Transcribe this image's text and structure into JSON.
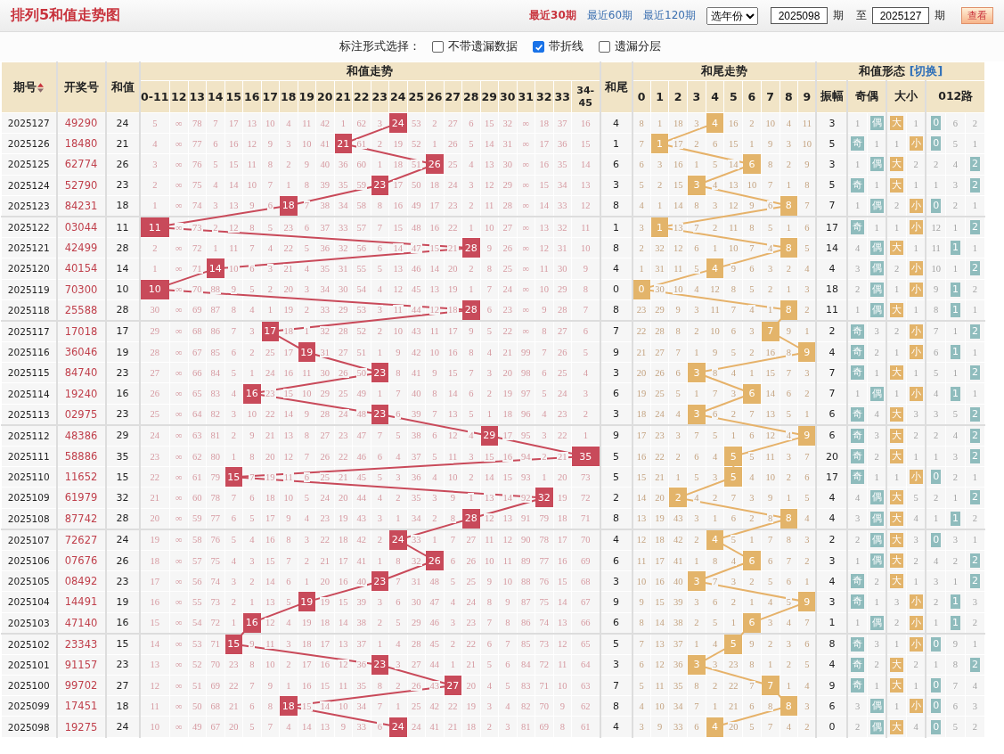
{
  "header": {
    "title": "排列5和值走势图",
    "period_links": [
      {
        "label": "最近30期",
        "selected": true
      },
      {
        "label": "最近60期",
        "selected": false
      },
      {
        "label": "最近120期",
        "selected": false
      }
    ],
    "year_select": "选年份",
    "from_issue": "2025098",
    "from_suffix": "期",
    "to_label": "至",
    "to_issue": "2025127",
    "to_suffix": "期",
    "view_button": "查看"
  },
  "options": {
    "label": "标注形式选择：",
    "checkboxes": [
      {
        "label": "不带遗漏数据",
        "checked": false
      },
      {
        "label": "带折线",
        "checked": true
      },
      {
        "label": "遗漏分层",
        "checked": false
      }
    ]
  },
  "table": {
    "issue_header": "期号",
    "number_header": "开奖号",
    "sum_header": "和值",
    "sum_trend_header": "和值走势",
    "tail_header": "和尾",
    "tail_trend_header": "和尾走势",
    "form_header": "和值形态",
    "switch_link": "[切换]",
    "amplitude_header": "振幅",
    "odd_even_header": "奇偶",
    "big_small_header": "大小",
    "route_header": "012路",
    "sum_columns": [
      "0-11",
      "12",
      "13",
      "14",
      "15",
      "16",
      "17",
      "18",
      "19",
      "20",
      "21",
      "22",
      "23",
      "24",
      "25",
      "26",
      "27",
      "28",
      "29",
      "30",
      "31",
      "32",
      "33",
      "34-45"
    ],
    "tail_columns": [
      "0",
      "1",
      "2",
      "3",
      "4",
      "5",
      "6",
      "7",
      "8",
      "9"
    ],
    "rows": [
      {
        "issue": "2025127",
        "number": "49290",
        "sum": "24",
        "sum_trend": [
          "5",
          "∞",
          "78",
          "7",
          "17",
          "13",
          "10",
          "4",
          "11",
          "42",
          "1",
          "62",
          "3",
          {
            "value": "24",
            "hit": true
          },
          "53",
          "2",
          "27",
          "6",
          "15",
          "32",
          "∞",
          "18",
          "37",
          "16"
        ],
        "tail": "4",
        "tail_trend": [
          "8",
          "1",
          "18",
          "3",
          {
            "value": "4",
            "hit": true
          },
          "16",
          "2",
          "10",
          "4",
          "11"
        ],
        "amplitude": "3",
        "odd_even": [
          "1",
          {
            "value": "偶",
            "hit": true
          }
        ],
        "big_small": [
          {
            "value": "大",
            "hit": true
          },
          "1"
        ],
        "route_012": [
          {
            "value": "0",
            "hit": true
          },
          "6",
          "2"
        ]
      },
      {
        "issue": "2025126",
        "number": "18480",
        "sum": "21",
        "sum_trend": [
          "4",
          "∞",
          "77",
          "6",
          "16",
          "12",
          "9",
          "3",
          "10",
          "41",
          {
            "value": "21",
            "hit": true
          },
          "61",
          "2",
          "19",
          "52",
          "1",
          "26",
          "5",
          "14",
          "31",
          "∞",
          "17",
          "36",
          "15"
        ],
        "tail": "1",
        "tail_trend": [
          "7",
          {
            "value": "1",
            "hit": true
          },
          "17",
          "2",
          "6",
          "15",
          "1",
          "9",
          "3",
          "10"
        ],
        "amplitude": "5",
        "odd_even": [
          {
            "value": "奇",
            "hit": true
          },
          "1"
        ],
        "big_small": [
          "1",
          {
            "value": "小",
            "hit": true
          }
        ],
        "route_012": [
          {
            "value": "0",
            "hit": true
          },
          "5",
          "1"
        ]
      },
      {
        "issue": "2025125",
        "number": "62774",
        "sum": "26",
        "sum_trend": [
          "3",
          "∞",
          "76",
          "5",
          "15",
          "11",
          "8",
          "2",
          "9",
          "40",
          "36",
          "60",
          "1",
          "18",
          "51",
          {
            "value": "26",
            "hit": true
          },
          "25",
          "4",
          "13",
          "30",
          "∞",
          "16",
          "35",
          "14"
        ],
        "tail": "6",
        "tail_trend": [
          "6",
          "3",
          "16",
          "1",
          "5",
          "14",
          {
            "value": "6",
            "hit": true
          },
          "8",
          "2",
          "9"
        ],
        "amplitude": "3",
        "odd_even": [
          "1",
          {
            "value": "偶",
            "hit": true
          }
        ],
        "big_small": [
          {
            "value": "大",
            "hit": true
          },
          "2"
        ],
        "route_012": [
          "2",
          "4",
          {
            "value": "2",
            "hit": true
          }
        ]
      },
      {
        "issue": "2025124",
        "number": "52790",
        "sum": "23",
        "sum_trend": [
          "2",
          "∞",
          "75",
          "4",
          "14",
          "10",
          "7",
          "1",
          "8",
          "39",
          "35",
          "59",
          {
            "value": "23",
            "hit": true
          },
          "17",
          "50",
          "18",
          "24",
          "3",
          "12",
          "29",
          "∞",
          "15",
          "34",
          "13"
        ],
        "tail": "3",
        "tail_trend": [
          "5",
          "2",
          "15",
          {
            "value": "3",
            "hit": true
          },
          "4",
          "13",
          "10",
          "7",
          "1",
          "8"
        ],
        "amplitude": "5",
        "odd_even": [
          {
            "value": "奇",
            "hit": true
          },
          "1"
        ],
        "big_small": [
          {
            "value": "大",
            "hit": true
          },
          "1"
        ],
        "route_012": [
          "1",
          "3",
          {
            "value": "2",
            "hit": true
          }
        ]
      },
      {
        "issue": "2025123",
        "number": "84231",
        "sum": "18",
        "sum_trend": [
          "1",
          "∞",
          "74",
          "3",
          "13",
          "9",
          "6",
          {
            "value": "18",
            "hit": true
          },
          "7",
          "38",
          "34",
          "58",
          "8",
          "16",
          "49",
          "17",
          "23",
          "2",
          "11",
          "28",
          "∞",
          "14",
          "33",
          "12"
        ],
        "tail": "8",
        "tail_trend": [
          "4",
          "1",
          "14",
          "8",
          "3",
          "12",
          "9",
          "6",
          {
            "value": "8",
            "hit": true
          },
          "7"
        ],
        "amplitude": "7",
        "odd_even": [
          "1",
          {
            "value": "偶",
            "hit": true
          }
        ],
        "big_small": [
          "2",
          {
            "value": "小",
            "hit": true
          }
        ],
        "route_012": [
          {
            "value": "0",
            "hit": true
          },
          "2",
          "1"
        ]
      },
      {
        "issue": "2025122",
        "number": "03044",
        "sum": "11",
        "sum_trend": [
          {
            "value": "11",
            "hit": true
          },
          "∞",
          "73",
          "2",
          "12",
          "8",
          "5",
          "23",
          "6",
          "37",
          "33",
          "57",
          "7",
          "15",
          "48",
          "16",
          "22",
          "1",
          "10",
          "27",
          "∞",
          "13",
          "32",
          "11"
        ],
        "tail": "1",
        "tail_trend": [
          "3",
          {
            "value": "1",
            "hit": true
          },
          "13",
          "7",
          "2",
          "11",
          "8",
          "5",
          "1",
          "6"
        ],
        "amplitude": "17",
        "odd_even": [
          {
            "value": "奇",
            "hit": true
          },
          "1"
        ],
        "big_small": [
          "1",
          {
            "value": "小",
            "hit": true
          }
        ],
        "route_012": [
          "12",
          "1",
          {
            "value": "2",
            "hit": true
          }
        ]
      },
      {
        "issue": "2025121",
        "number": "42499",
        "sum": "28",
        "sum_trend": [
          "2",
          "∞",
          "72",
          "1",
          "11",
          "7",
          "4",
          "22",
          "5",
          "36",
          "32",
          "56",
          "6",
          "14",
          "47",
          "15",
          "21",
          {
            "value": "28",
            "hit": true
          },
          "9",
          "26",
          "∞",
          "12",
          "31",
          "10"
        ],
        "tail": "8",
        "tail_trend": [
          "2",
          "32",
          "12",
          "6",
          "1",
          "10",
          "7",
          "4",
          {
            "value": "8",
            "hit": true
          },
          "5"
        ],
        "amplitude": "14",
        "odd_even": [
          "4",
          {
            "value": "偶",
            "hit": true
          }
        ],
        "big_small": [
          {
            "value": "大",
            "hit": true
          },
          "1"
        ],
        "route_012": [
          "11",
          {
            "value": "1",
            "hit": true
          },
          "1"
        ]
      },
      {
        "issue": "2025120",
        "number": "40154",
        "sum": "14",
        "sum_trend": [
          "1",
          "∞",
          "71",
          {
            "value": "14",
            "hit": true
          },
          "10",
          "6",
          "3",
          "21",
          "4",
          "35",
          "31",
          "55",
          "5",
          "13",
          "46",
          "14",
          "20",
          "2",
          "8",
          "25",
          "∞",
          "11",
          "30",
          "9"
        ],
        "tail": "4",
        "tail_trend": [
          "1",
          "31",
          "11",
          "5",
          {
            "value": "4",
            "hit": true
          },
          "9",
          "6",
          "3",
          "2",
          "4"
        ],
        "amplitude": "4",
        "odd_even": [
          "3",
          {
            "value": "偶",
            "hit": true
          }
        ],
        "big_small": [
          "2",
          {
            "value": "小",
            "hit": true
          }
        ],
        "route_012": [
          "10",
          "1",
          {
            "value": "2",
            "hit": true
          }
        ]
      },
      {
        "issue": "2025119",
        "number": "70300",
        "sum": "10",
        "sum_trend": [
          {
            "value": "10",
            "hit": true
          },
          "∞",
          "70",
          "88",
          "9",
          "5",
          "2",
          "20",
          "3",
          "34",
          "30",
          "54",
          "4",
          "12",
          "45",
          "13",
          "19",
          "1",
          "7",
          "24",
          "∞",
          "10",
          "29",
          "8"
        ],
        "tail": "0",
        "tail_trend": [
          {
            "value": "0",
            "hit": true
          },
          "30",
          "10",
          "4",
          "12",
          "8",
          "5",
          "2",
          "1",
          "3"
        ],
        "amplitude": "18",
        "odd_even": [
          "2",
          {
            "value": "偶",
            "hit": true
          }
        ],
        "big_small": [
          "1",
          {
            "value": "小",
            "hit": true
          }
        ],
        "route_012": [
          "9",
          {
            "value": "1",
            "hit": true
          },
          "2"
        ]
      },
      {
        "issue": "2025118",
        "number": "25588",
        "sum": "28",
        "sum_trend": [
          "30",
          "∞",
          "69",
          "87",
          "8",
          "4",
          "1",
          "19",
          "2",
          "33",
          "29",
          "53",
          "3",
          "11",
          "44",
          "12",
          "18",
          {
            "value": "28",
            "hit": true
          },
          "6",
          "23",
          "∞",
          "9",
          "28",
          "7"
        ],
        "tail": "8",
        "tail_trend": [
          "23",
          "29",
          "9",
          "3",
          "11",
          "7",
          "4",
          "1",
          {
            "value": "8",
            "hit": true
          },
          "2"
        ],
        "amplitude": "11",
        "odd_even": [
          "1",
          {
            "value": "偶",
            "hit": true
          }
        ],
        "big_small": [
          {
            "value": "大",
            "hit": true
          },
          "1"
        ],
        "route_012": [
          "8",
          {
            "value": "1",
            "hit": true
          },
          "1"
        ]
      },
      {
        "issue": "2025117",
        "number": "17018",
        "sum": "17",
        "sum_trend": [
          "29",
          "∞",
          "68",
          "86",
          "7",
          "3",
          {
            "value": "17",
            "hit": true
          },
          "18",
          "1",
          "32",
          "28",
          "52",
          "2",
          "10",
          "43",
          "11",
          "17",
          "9",
          "5",
          "22",
          "∞",
          "8",
          "27",
          "6"
        ],
        "tail": "7",
        "tail_trend": [
          "22",
          "28",
          "8",
          "2",
          "10",
          "6",
          "3",
          {
            "value": "7",
            "hit": true
          },
          "9",
          "1"
        ],
        "amplitude": "2",
        "odd_even": [
          {
            "value": "奇",
            "hit": true
          },
          "3"
        ],
        "big_small": [
          "2",
          {
            "value": "小",
            "hit": true
          }
        ],
        "route_012": [
          "7",
          "1",
          {
            "value": "2",
            "hit": true
          }
        ]
      },
      {
        "issue": "2025116",
        "number": "36046",
        "sum": "19",
        "sum_trend": [
          "28",
          "∞",
          "67",
          "85",
          "6",
          "2",
          "25",
          "17",
          {
            "value": "19",
            "hit": true
          },
          "31",
          "27",
          "51",
          "1",
          "9",
          "42",
          "10",
          "16",
          "8",
          "4",
          "21",
          "99",
          "7",
          "26",
          "5"
        ],
        "tail": "9",
        "tail_trend": [
          "21",
          "27",
          "7",
          "1",
          "9",
          "5",
          "2",
          "16",
          "8",
          {
            "value": "9",
            "hit": true
          }
        ],
        "amplitude": "4",
        "odd_even": [
          {
            "value": "奇",
            "hit": true
          },
          "2"
        ],
        "big_small": [
          "1",
          {
            "value": "小",
            "hit": true
          }
        ],
        "route_012": [
          "6",
          {
            "value": "1",
            "hit": true
          },
          "1"
        ]
      },
      {
        "issue": "2025115",
        "number": "84740",
        "sum": "23",
        "sum_trend": [
          "27",
          "∞",
          "66",
          "84",
          "5",
          "1",
          "24",
          "16",
          "11",
          "30",
          "26",
          "50",
          {
            "value": "23",
            "hit": true
          },
          "8",
          "41",
          "9",
          "15",
          "7",
          "3",
          "20",
          "98",
          "6",
          "25",
          "4"
        ],
        "tail": "3",
        "tail_trend": [
          "20",
          "26",
          "6",
          {
            "value": "3",
            "hit": true
          },
          "8",
          "4",
          "1",
          "15",
          "7",
          "3"
        ],
        "amplitude": "7",
        "odd_even": [
          {
            "value": "奇",
            "hit": true
          },
          "1"
        ],
        "big_small": [
          {
            "value": "大",
            "hit": true
          },
          "1"
        ],
        "route_012": [
          "5",
          "1",
          {
            "value": "2",
            "hit": true
          }
        ]
      },
      {
        "issue": "2025114",
        "number": "19240",
        "sum": "16",
        "sum_trend": [
          "26",
          "∞",
          "65",
          "83",
          "4",
          {
            "value": "16",
            "hit": true
          },
          "23",
          "15",
          "10",
          "29",
          "25",
          "49",
          "1",
          "7",
          "40",
          "8",
          "14",
          "6",
          "2",
          "19",
          "97",
          "5",
          "24",
          "3"
        ],
        "tail": "6",
        "tail_trend": [
          "19",
          "25",
          "5",
          "1",
          "7",
          "3",
          {
            "value": "6",
            "hit": true
          },
          "14",
          "6",
          "2"
        ],
        "amplitude": "7",
        "odd_even": [
          "1",
          {
            "value": "偶",
            "hit": true
          }
        ],
        "big_small": [
          "1",
          {
            "value": "小",
            "hit": true
          }
        ],
        "route_012": [
          "4",
          {
            "value": "1",
            "hit": true
          },
          "1"
        ]
      },
      {
        "issue": "2025113",
        "number": "02975",
        "sum": "23",
        "sum_trend": [
          "25",
          "∞",
          "64",
          "82",
          "3",
          "10",
          "22",
          "14",
          "9",
          "28",
          "24",
          "48",
          {
            "value": "23",
            "hit": true
          },
          "6",
          "39",
          "7",
          "13",
          "5",
          "1",
          "18",
          "96",
          "4",
          "23",
          "2"
        ],
        "tail": "3",
        "tail_trend": [
          "18",
          "24",
          "4",
          {
            "value": "3",
            "hit": true
          },
          "6",
          "2",
          "7",
          "13",
          "5",
          "1"
        ],
        "amplitude": "6",
        "odd_even": [
          {
            "value": "奇",
            "hit": true
          },
          "4"
        ],
        "big_small": [
          {
            "value": "大",
            "hit": true
          },
          "3"
        ],
        "route_012": [
          "3",
          "5",
          {
            "value": "2",
            "hit": true
          }
        ]
      },
      {
        "issue": "2025112",
        "number": "48386",
        "sum": "29",
        "sum_trend": [
          "24",
          "∞",
          "63",
          "81",
          "2",
          "9",
          "21",
          "13",
          "8",
          "27",
          "23",
          "47",
          "7",
          "5",
          "38",
          "6",
          "12",
          "4",
          {
            "value": "29",
            "hit": true
          },
          "17",
          "95",
          "3",
          "22",
          "1"
        ],
        "tail": "9",
        "tail_trend": [
          "17",
          "23",
          "3",
          "7",
          "5",
          "1",
          "6",
          "12",
          "4",
          {
            "value": "9",
            "hit": true
          }
        ],
        "amplitude": "6",
        "odd_even": [
          {
            "value": "奇",
            "hit": true
          },
          "3"
        ],
        "big_small": [
          {
            "value": "大",
            "hit": true
          },
          "2"
        ],
        "route_012": [
          "2",
          "4",
          {
            "value": "2",
            "hit": true
          }
        ]
      },
      {
        "issue": "2025111",
        "number": "58886",
        "sum": "35",
        "sum_trend": [
          "23",
          "∞",
          "62",
          "80",
          "1",
          "8",
          "20",
          "12",
          "7",
          "26",
          "22",
          "46",
          "6",
          "4",
          "37",
          "5",
          "11",
          "3",
          "15",
          "16",
          "94",
          "2",
          "21",
          {
            "value": "35",
            "hit": true
          }
        ],
        "tail": "5",
        "tail_trend": [
          "16",
          "22",
          "2",
          "6",
          "4",
          {
            "value": "5",
            "hit": true
          },
          "5",
          "11",
          "3",
          "7"
        ],
        "amplitude": "20",
        "odd_even": [
          {
            "value": "奇",
            "hit": true
          },
          "2"
        ],
        "big_small": [
          {
            "value": "大",
            "hit": true
          },
          "1"
        ],
        "route_012": [
          "1",
          "3",
          {
            "value": "2",
            "hit": true
          }
        ]
      },
      {
        "issue": "2025110",
        "number": "11652",
        "sum": "15",
        "sum_trend": [
          "22",
          "∞",
          "61",
          "79",
          {
            "value": "15",
            "hit": true
          },
          "7",
          "19",
          "11",
          "6",
          "25",
          "21",
          "45",
          "5",
          "3",
          "36",
          "4",
          "10",
          "2",
          "14",
          "15",
          "93",
          "1",
          "20",
          "73"
        ],
        "tail": "5",
        "tail_trend": [
          "15",
          "21",
          "1",
          "5",
          "3",
          {
            "value": "5",
            "hit": true
          },
          "4",
          "10",
          "2",
          "6"
        ],
        "amplitude": "17",
        "odd_even": [
          {
            "value": "奇",
            "hit": true
          },
          "1"
        ],
        "big_small": [
          "1",
          {
            "value": "小",
            "hit": true
          }
        ],
        "route_012": [
          {
            "value": "0",
            "hit": true
          },
          "2",
          "1"
        ]
      },
      {
        "issue": "2025109",
        "number": "61979",
        "sum": "32",
        "sum_trend": [
          "21",
          "∞",
          "60",
          "78",
          "7",
          "6",
          "18",
          "10",
          "5",
          "24",
          "20",
          "44",
          "4",
          "2",
          "35",
          "3",
          "9",
          "1",
          "13",
          "14",
          "92",
          {
            "value": "32",
            "hit": true
          },
          "19",
          "72"
        ],
        "tail": "2",
        "tail_trend": [
          "14",
          "20",
          {
            "value": "2",
            "hit": true
          },
          "4",
          "2",
          "7",
          "3",
          "9",
          "1",
          "5"
        ],
        "amplitude": "4",
        "odd_even": [
          "4",
          {
            "value": "偶",
            "hit": true
          }
        ],
        "big_small": [
          {
            "value": "大",
            "hit": true
          },
          "5"
        ],
        "route_012": [
          "2",
          "1",
          {
            "value": "2",
            "hit": true
          }
        ]
      },
      {
        "issue": "2025108",
        "number": "87742",
        "sum": "28",
        "sum_trend": [
          "20",
          "∞",
          "59",
          "77",
          "6",
          "5",
          "17",
          "9",
          "4",
          "23",
          "19",
          "43",
          "3",
          "1",
          "34",
          "2",
          "8",
          {
            "value": "28",
            "hit": true
          },
          "12",
          "13",
          "91",
          "79",
          "18",
          "71"
        ],
        "tail": "8",
        "tail_trend": [
          "13",
          "19",
          "43",
          "3",
          "1",
          "6",
          "2",
          "8",
          {
            "value": "8",
            "hit": true
          },
          "4"
        ],
        "amplitude": "4",
        "odd_even": [
          "3",
          {
            "value": "偶",
            "hit": true
          }
        ],
        "big_small": [
          {
            "value": "大",
            "hit": true
          },
          "4"
        ],
        "route_012": [
          "1",
          {
            "value": "1",
            "hit": true
          },
          "2"
        ]
      },
      {
        "issue": "2025107",
        "number": "72627",
        "sum": "24",
        "sum_trend": [
          "19",
          "∞",
          "58",
          "76",
          "5",
          "4",
          "16",
          "8",
          "3",
          "22",
          "18",
          "42",
          "2",
          {
            "value": "24",
            "hit": true
          },
          "33",
          "1",
          "7",
          "27",
          "11",
          "12",
          "90",
          "78",
          "17",
          "70"
        ],
        "tail": "4",
        "tail_trend": [
          "12",
          "18",
          "42",
          "2",
          {
            "value": "4",
            "hit": true
          },
          "5",
          "1",
          "7",
          "8",
          "3"
        ],
        "amplitude": "2",
        "odd_even": [
          "2",
          {
            "value": "偶",
            "hit": true
          }
        ],
        "big_small": [
          {
            "value": "大",
            "hit": true
          },
          "3"
        ],
        "route_012": [
          {
            "value": "0",
            "hit": true
          },
          "3",
          "1"
        ]
      },
      {
        "issue": "2025106",
        "number": "07676",
        "sum": "26",
        "sum_trend": [
          "18",
          "∞",
          "57",
          "75",
          "4",
          "3",
          "15",
          "7",
          "2",
          "21",
          "17",
          "41",
          "1",
          "8",
          "32",
          {
            "value": "26",
            "hit": true
          },
          "6",
          "26",
          "10",
          "11",
          "89",
          "77",
          "16",
          "69"
        ],
        "tail": "6",
        "tail_trend": [
          "11",
          "17",
          "41",
          "1",
          "8",
          "4",
          {
            "value": "6",
            "hit": true
          },
          "6",
          "7",
          "2"
        ],
        "amplitude": "3",
        "odd_even": [
          "1",
          {
            "value": "偶",
            "hit": true
          }
        ],
        "big_small": [
          {
            "value": "大",
            "hit": true
          },
          "2"
        ],
        "route_012": [
          "4",
          "2",
          {
            "value": "2",
            "hit": true
          }
        ]
      },
      {
        "issue": "2025105",
        "number": "08492",
        "sum": "23",
        "sum_trend": [
          "17",
          "∞",
          "56",
          "74",
          "3",
          "2",
          "14",
          "6",
          "1",
          "20",
          "16",
          "40",
          {
            "value": "23",
            "hit": true
          },
          "7",
          "31",
          "48",
          "5",
          "25",
          "9",
          "10",
          "88",
          "76",
          "15",
          "68"
        ],
        "tail": "3",
        "tail_trend": [
          "10",
          "16",
          "40",
          {
            "value": "3",
            "hit": true
          },
          "7",
          "3",
          "2",
          "5",
          "6",
          "1"
        ],
        "amplitude": "4",
        "odd_even": [
          {
            "value": "奇",
            "hit": true
          },
          "2"
        ],
        "big_small": [
          {
            "value": "大",
            "hit": true
          },
          "1"
        ],
        "route_012": [
          "3",
          "1",
          {
            "value": "2",
            "hit": true
          }
        ]
      },
      {
        "issue": "2025104",
        "number": "14491",
        "sum": "19",
        "sum_trend": [
          "16",
          "∞",
          "55",
          "73",
          "2",
          "1",
          "13",
          "5",
          {
            "value": "19",
            "hit": true
          },
          "19",
          "15",
          "39",
          "3",
          "6",
          "30",
          "47",
          "4",
          "24",
          "8",
          "9",
          "87",
          "75",
          "14",
          "67"
        ],
        "tail": "9",
        "tail_trend": [
          "9",
          "15",
          "39",
          "3",
          "6",
          "2",
          "1",
          "4",
          "5",
          {
            "value": "9",
            "hit": true
          }
        ],
        "amplitude": "3",
        "odd_even": [
          {
            "value": "奇",
            "hit": true
          },
          "1"
        ],
        "big_small": [
          "3",
          {
            "value": "小",
            "hit": true
          }
        ],
        "route_012": [
          "2",
          {
            "value": "1",
            "hit": true
          },
          "3"
        ]
      },
      {
        "issue": "2025103",
        "number": "47140",
        "sum": "16",
        "sum_trend": [
          "15",
          "∞",
          "54",
          "72",
          "1",
          {
            "value": "16",
            "hit": true
          },
          "12",
          "4",
          "19",
          "18",
          "14",
          "38",
          "2",
          "5",
          "29",
          "46",
          "3",
          "23",
          "7",
          "8",
          "86",
          "74",
          "13",
          "66"
        ],
        "tail": "6",
        "tail_trend": [
          "8",
          "14",
          "38",
          "2",
          "5",
          "1",
          {
            "value": "6",
            "hit": true
          },
          "3",
          "4",
          "7"
        ],
        "amplitude": "1",
        "odd_even": [
          "1",
          {
            "value": "偶",
            "hit": true
          }
        ],
        "big_small": [
          "2",
          {
            "value": "小",
            "hit": true
          }
        ],
        "route_012": [
          "1",
          {
            "value": "1",
            "hit": true
          },
          "2"
        ]
      },
      {
        "issue": "2025102",
        "number": "23343",
        "sum": "15",
        "sum_trend": [
          "14",
          "∞",
          "53",
          "71",
          {
            "value": "15",
            "hit": true
          },
          "9",
          "11",
          "3",
          "18",
          "17",
          "13",
          "37",
          "1",
          "4",
          "28",
          "45",
          "2",
          "22",
          "6",
          "7",
          "85",
          "73",
          "12",
          "65"
        ],
        "tail": "5",
        "tail_trend": [
          "7",
          "13",
          "37",
          "1",
          "4",
          {
            "value": "5",
            "hit": true
          },
          "9",
          "2",
          "3",
          "6"
        ],
        "amplitude": "8",
        "odd_even": [
          {
            "value": "奇",
            "hit": true
          },
          "3"
        ],
        "big_small": [
          "1",
          {
            "value": "小",
            "hit": true
          }
        ],
        "route_012": [
          {
            "value": "0",
            "hit": true
          },
          "9",
          "1"
        ]
      },
      {
        "issue": "2025101",
        "number": "91157",
        "sum": "23",
        "sum_trend": [
          "13",
          "∞",
          "52",
          "70",
          "23",
          "8",
          "10",
          "2",
          "17",
          "16",
          "12",
          "36",
          {
            "value": "23",
            "hit": true
          },
          "3",
          "27",
          "44",
          "1",
          "21",
          "5",
          "6",
          "84",
          "72",
          "11",
          "64"
        ],
        "tail": "3",
        "tail_trend": [
          "6",
          "12",
          "36",
          {
            "value": "3",
            "hit": true
          },
          "3",
          "23",
          "8",
          "1",
          "2",
          "5"
        ],
        "amplitude": "4",
        "odd_even": [
          {
            "value": "奇",
            "hit": true
          },
          "2"
        ],
        "big_small": [
          {
            "value": "大",
            "hit": true
          },
          "2"
        ],
        "route_012": [
          "1",
          "8",
          {
            "value": "2",
            "hit": true
          }
        ]
      },
      {
        "issue": "2025100",
        "number": "99702",
        "sum": "27",
        "sum_trend": [
          "12",
          "∞",
          "51",
          "69",
          "22",
          "7",
          "9",
          "1",
          "16",
          "15",
          "11",
          "35",
          "8",
          "2",
          "26",
          "43",
          {
            "value": "27",
            "hit": true
          },
          "20",
          "4",
          "5",
          "83",
          "71",
          "10",
          "63"
        ],
        "tail": "7",
        "tail_trend": [
          "5",
          "11",
          "35",
          "8",
          "2",
          "22",
          "7",
          {
            "value": "7",
            "hit": true
          },
          "1",
          "4"
        ],
        "amplitude": "9",
        "odd_even": [
          {
            "value": "奇",
            "hit": true
          },
          "1"
        ],
        "big_small": [
          {
            "value": "大",
            "hit": true
          },
          "1"
        ],
        "route_012": [
          {
            "value": "0",
            "hit": true
          },
          "7",
          "4"
        ]
      },
      {
        "issue": "2025099",
        "number": "17451",
        "sum": "18",
        "sum_trend": [
          "11",
          "∞",
          "50",
          "68",
          "21",
          "6",
          "8",
          {
            "value": "18",
            "hit": true
          },
          "15",
          "14",
          "10",
          "34",
          "7",
          "1",
          "25",
          "42",
          "22",
          "19",
          "3",
          "4",
          "82",
          "70",
          "9",
          "62"
        ],
        "tail": "8",
        "tail_trend": [
          "4",
          "10",
          "34",
          "7",
          "1",
          "21",
          "6",
          "8",
          {
            "value": "8",
            "hit": true
          },
          "3"
        ],
        "amplitude": "6",
        "odd_even": [
          "3",
          {
            "value": "偶",
            "hit": true
          }
        ],
        "big_small": [
          "1",
          {
            "value": "小",
            "hit": true
          }
        ],
        "route_012": [
          {
            "value": "0",
            "hit": true
          },
          "6",
          "3"
        ]
      },
      {
        "issue": "2025098",
        "number": "19275",
        "sum": "24",
        "sum_trend": [
          "10",
          "∞",
          "49",
          "67",
          "20",
          "5",
          "7",
          "4",
          "14",
          "13",
          "9",
          "33",
          "6",
          {
            "value": "24",
            "hit": true
          },
          "24",
          "41",
          "21",
          "18",
          "2",
          "3",
          "81",
          "69",
          "8",
          "61"
        ],
        "tail": "4",
        "tail_trend": [
          "3",
          "9",
          "33",
          "6",
          {
            "value": "4",
            "hit": true
          },
          "20",
          "5",
          "7",
          "4",
          "2"
        ],
        "amplitude": "0",
        "odd_even": [
          "2",
          {
            "value": "偶",
            "hit": true
          }
        ],
        "big_small": [
          {
            "value": "大",
            "hit": true
          },
          "4"
        ],
        "route_012": [
          {
            "value": "0",
            "hit": true
          },
          "5",
          "2"
        ]
      }
    ]
  }
}
